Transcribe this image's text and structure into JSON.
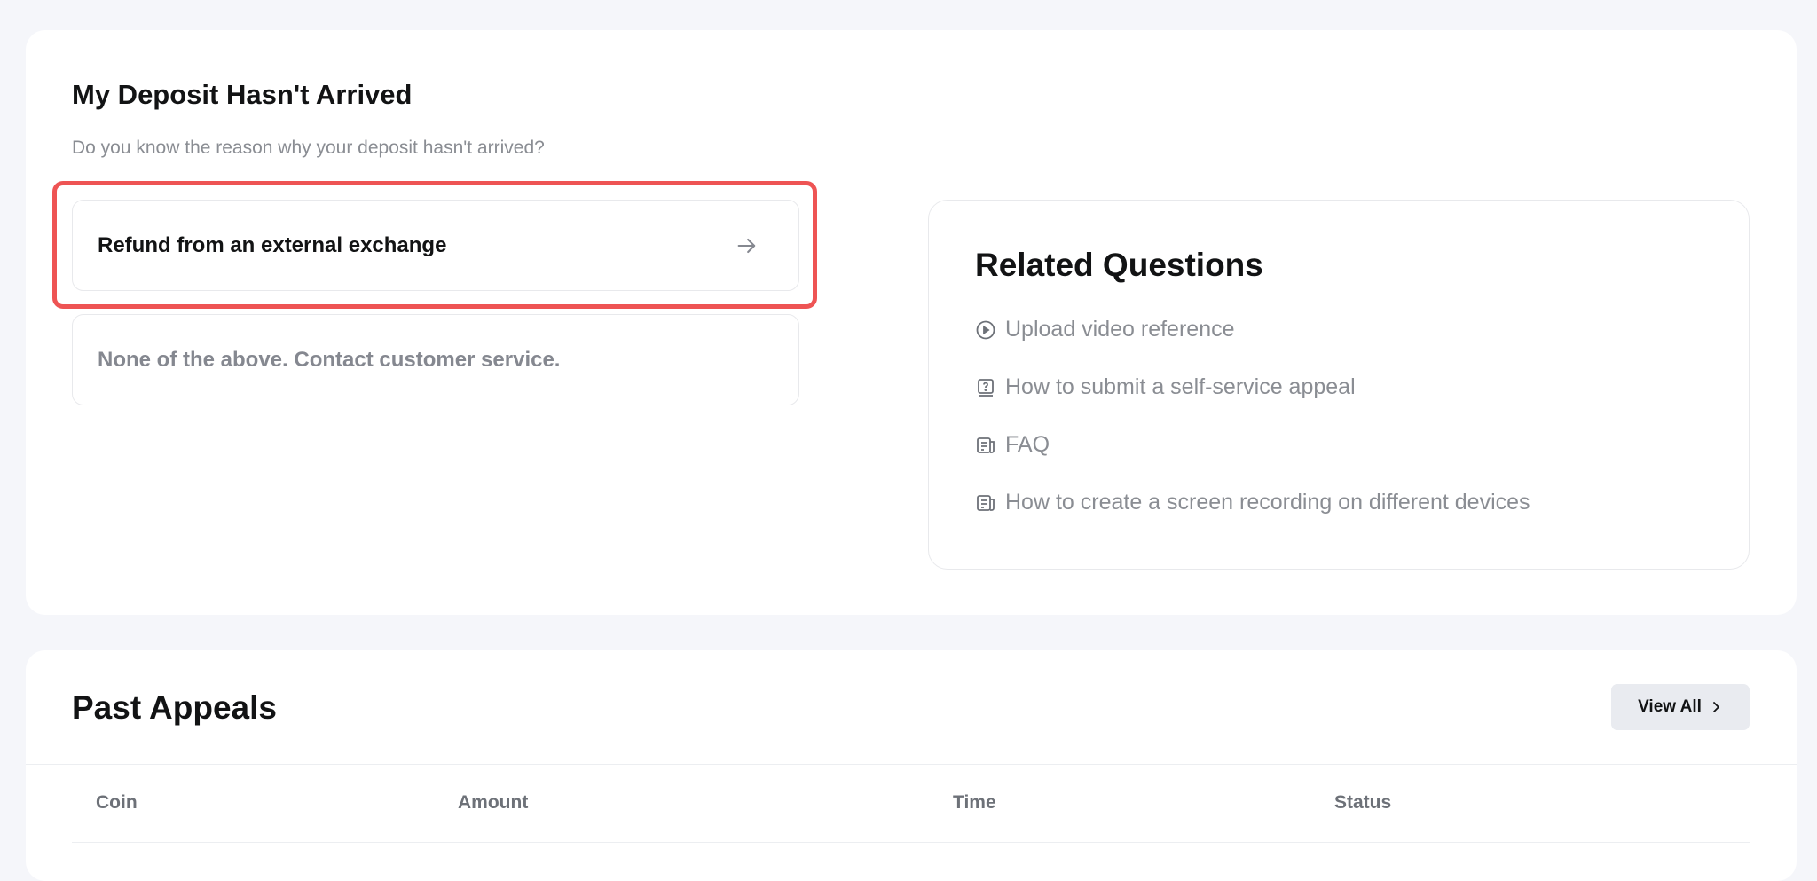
{
  "deposit": {
    "title": "My Deposit Hasn't Arrived",
    "subtitle": "Do you know the reason why your deposit hasn't arrived?",
    "options": [
      {
        "label": "Refund from an external exchange",
        "icon": "arrow-right-icon"
      },
      {
        "label": "None of the above. Contact customer service."
      }
    ],
    "highlight_color": "#ee5454"
  },
  "related": {
    "title": "Related Questions",
    "items": [
      {
        "label": "Upload video reference",
        "icon": "play-circle-icon"
      },
      {
        "label": "How to submit a self-service appeal",
        "icon": "question-card-icon"
      },
      {
        "label": "FAQ",
        "icon": "document-icon"
      },
      {
        "label": "How to create a screen recording on different devices",
        "icon": "document-icon"
      }
    ]
  },
  "appeals": {
    "title": "Past Appeals",
    "view_all_label": "View All",
    "columns": [
      "Coin",
      "Amount",
      "Time",
      "Status"
    ]
  }
}
